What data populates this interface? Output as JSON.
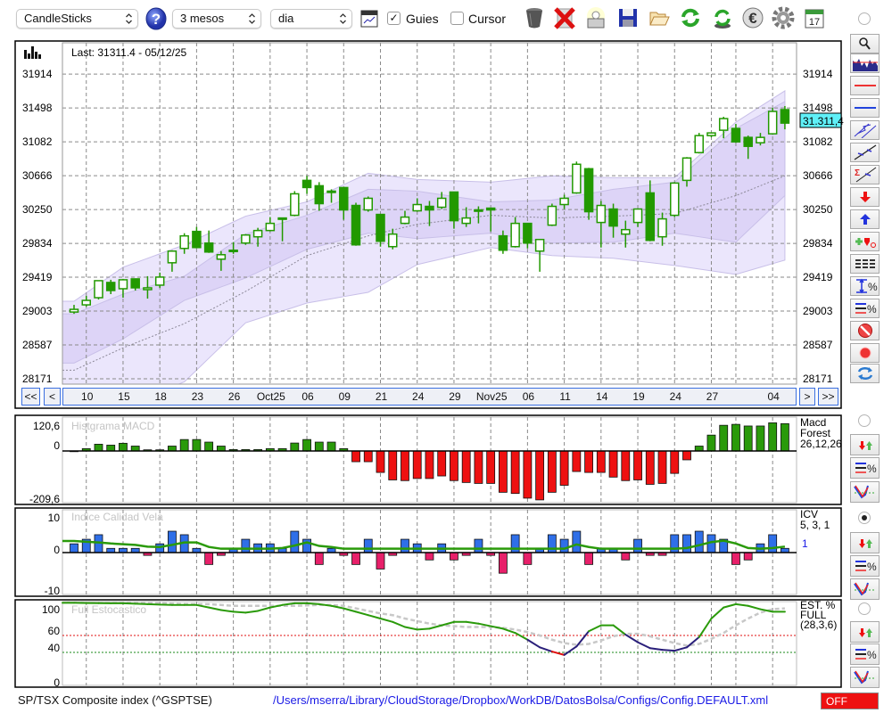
{
  "toolbar": {
    "chart_type": "CandleSticks",
    "period": "3 mesos",
    "interval": "dia",
    "guides_label": "Guies",
    "guides_checked": true,
    "guides_mark": "✓",
    "cursor_label": "Cursor",
    "cursor_checked": false,
    "help_glyph": "?",
    "calendar_day": "17",
    "icons": [
      "help-icon",
      "chart-settings-icon",
      "trash-icon",
      "delete-icon",
      "lamp-icon",
      "save-icon",
      "folder-open-icon",
      "refresh-icon",
      "sync-icon",
      "euro-icon",
      "gear-icon",
      "calendar-icon"
    ]
  },
  "main_chart": {
    "last_label": "Last: 31311.4 - 05/12/25",
    "price_tag": "31.311,4",
    "nav": {
      "first": "<<",
      "prev": "<",
      "next": ">",
      "last": ">>"
    }
  },
  "side_panel": {
    "tools": [
      "zoom-icon",
      "overview-icon",
      "red-line-icon",
      "blue-line-icon",
      "channel-icon",
      "trendline-icon",
      "sum-trendline-icon",
      "sell-arrow-icon",
      "buy-arrow-icon",
      "add-signal-icon",
      "dashed-lines-icon",
      "percent-range-icon",
      "percent-lines-icon",
      "no-entry-icon",
      "record-icon",
      "swap-icon"
    ]
  },
  "status": {
    "instrument": "SP/TSX Composite index (^GSPTSE)",
    "config_path": "/Users/mserra/Library/CloudStorage/Dropbox/WorkDB/DatosBolsa/Configs/Config.DEFAULT.xml",
    "off_label": "OFF"
  },
  "colors": {
    "candle": "#229900",
    "macd_pos": "#2a9a0a",
    "macd_neg": "#ee1111",
    "icv_pos": "#2f6fe8",
    "icv_neg": "#e8206a",
    "band_outer": "#ebe6fc",
    "band_inner": "#ddd4f7",
    "off": "#ee1111",
    "price_tag": "#5ff0f8"
  },
  "chart_data": [
    {
      "type": "candlestick",
      "title": "SP/TSX Composite index (^GSPTSE)",
      "ylim": [
        28171,
        32000
      ],
      "y_ticks": [
        "28171",
        "28587",
        "29003",
        "29419",
        "29834",
        "30250",
        "30666",
        "31082",
        "31498",
        "31914"
      ],
      "y_tick_values": [
        28171,
        28587,
        29003,
        29419,
        29834,
        30250,
        30666,
        31082,
        31498,
        31914
      ],
      "x_labels": [
        {
          "index": 1,
          "label": "10"
        },
        {
          "index": 4,
          "label": "15"
        },
        {
          "index": 7,
          "label": "18"
        },
        {
          "index": 10,
          "label": "23"
        },
        {
          "index": 13,
          "label": "26"
        },
        {
          "index": 16,
          "label": "Oct25"
        },
        {
          "index": 19,
          "label": "06"
        },
        {
          "index": 22,
          "label": "09"
        },
        {
          "index": 25,
          "label": "21"
        },
        {
          "index": 28,
          "label": "24"
        },
        {
          "index": 31,
          "label": "29"
        },
        {
          "index": 34,
          "label": "Nov25"
        },
        {
          "index": 37,
          "label": "06"
        },
        {
          "index": 40,
          "label": "11"
        },
        {
          "index": 43,
          "label": "14"
        },
        {
          "index": 46,
          "label": "19"
        },
        {
          "index": 49,
          "label": "24"
        },
        {
          "index": 52,
          "label": "27"
        },
        {
          "index": 57,
          "label": "04"
        }
      ],
      "ohlc": [
        [
          28991,
          29079,
          28969,
          29024
        ],
        [
          29079,
          29189,
          29057,
          29134
        ],
        [
          29167,
          29376,
          29145,
          29376
        ],
        [
          29354,
          29387,
          29211,
          29255
        ],
        [
          29277,
          29398,
          29167,
          29387
        ],
        [
          29398,
          29398,
          29255,
          29288
        ],
        [
          29266,
          29431,
          29156,
          29288
        ],
        [
          29321,
          29475,
          29288,
          29420
        ],
        [
          29596,
          29750,
          29486,
          29739
        ],
        [
          29772,
          29959,
          29706,
          29926
        ],
        [
          29981,
          30036,
          29772,
          29783
        ],
        [
          29838,
          29992,
          29717,
          29728
        ],
        [
          29640,
          29739,
          29497,
          29695
        ],
        [
          29750,
          29849,
          29706,
          29739
        ],
        [
          29838,
          29948,
          29816,
          29937
        ],
        [
          29915,
          30025,
          29794,
          29992
        ],
        [
          29992,
          30157,
          29981,
          30080
        ],
        [
          30135,
          30146,
          29860,
          30146
        ],
        [
          30179,
          30476,
          30168,
          30443
        ],
        [
          30608,
          30663,
          30443,
          30520
        ],
        [
          30542,
          30586,
          30234,
          30322
        ],
        [
          30465,
          30498,
          30333,
          30476
        ],
        [
          30520,
          30520,
          30124,
          30245
        ],
        [
          30300,
          30333,
          29805,
          29816
        ],
        [
          30245,
          30410,
          30223,
          30388
        ],
        [
          30190,
          30190,
          29794,
          29860
        ],
        [
          29794,
          30014,
          29761,
          29948
        ],
        [
          30080,
          30234,
          30069,
          30157
        ],
        [
          30234,
          30388,
          30223,
          30311
        ],
        [
          30289,
          30355,
          30047,
          30245
        ],
        [
          30278,
          30465,
          30256,
          30388
        ],
        [
          30465,
          30465,
          30014,
          30113
        ],
        [
          30080,
          30278,
          30036,
          30146
        ],
        [
          30234,
          30289,
          30080,
          30245
        ],
        [
          30267,
          30267,
          29981,
          30245
        ],
        [
          29926,
          29992,
          29706,
          29750
        ],
        [
          29794,
          30157,
          29783,
          30080
        ],
        [
          30080,
          30080,
          29772,
          29838
        ],
        [
          29739,
          29882,
          29486,
          29882
        ],
        [
          30058,
          30322,
          30047,
          30289
        ],
        [
          30311,
          30432,
          30256,
          30388
        ],
        [
          30454,
          30839,
          30443,
          30806
        ],
        [
          30751,
          30762,
          30124,
          30223
        ],
        [
          30091,
          30355,
          29783,
          30300
        ],
        [
          30256,
          30322,
          29904,
          30047
        ],
        [
          29948,
          30113,
          29783,
          30003
        ],
        [
          30091,
          30256,
          30036,
          30256
        ],
        [
          30454,
          30608,
          29860,
          29871
        ],
        [
          29915,
          30212,
          29805,
          30135
        ],
        [
          30179,
          30586,
          30157,
          30575
        ],
        [
          30608,
          30894,
          30531,
          30883
        ],
        [
          30949,
          31191,
          30938,
          31158
        ],
        [
          31158,
          31191,
          31136,
          31191
        ],
        [
          31224,
          31389,
          31125,
          31367
        ],
        [
          31246,
          31301,
          31070,
          31081
        ],
        [
          31136,
          31158,
          30872,
          31026
        ],
        [
          31070,
          31191,
          31037,
          31136
        ],
        [
          31180,
          31499,
          31169,
          31455
        ],
        [
          31477,
          31521,
          31235,
          31311.4
        ]
      ],
      "last_close": 31311.4,
      "bands": {
        "anchor_index": [
          0,
          4,
          9,
          14,
          19,
          24,
          28,
          34,
          39,
          44,
          49,
          54,
          58
        ],
        "upper_outer": [
          29123,
          29541,
          29816,
          30168,
          30344,
          30696,
          30619,
          30586,
          30663,
          30641,
          30641,
          31323,
          31708
        ],
        "upper_inner": [
          28969,
          29211,
          29431,
          29948,
          30179,
          30498,
          30476,
          30344,
          30366,
          30498,
          30586,
          31246,
          31576
        ],
        "middle": [
          28276,
          28551,
          28848,
          29244,
          29684,
          29926,
          30069,
          30179,
          30146,
          30168,
          30201,
          30421,
          30663
        ],
        "lower_inner": [
          28364,
          28661,
          29134,
          29409,
          29761,
          29959,
          29893,
          29959,
          29838,
          29849,
          29959,
          29849,
          30421
        ],
        "lower_outer": [
          27671,
          27836,
          28133,
          28859,
          29101,
          29233,
          29574,
          29783,
          29684,
          29651,
          29563,
          29453,
          29629
        ]
      }
    },
    {
      "type": "bar",
      "title": "Histgrama MACD",
      "legend": [
        "Macd",
        "Forest",
        "26,12,26"
      ],
      "y_ticks": [
        "120,6",
        "0",
        "-209,6"
      ],
      "ylim": [
        -209.6,
        120.6
      ],
      "values": [
        0,
        10,
        29,
        25,
        33,
        21,
        5,
        5,
        21,
        49,
        49,
        38,
        21,
        6,
        6,
        6,
        10,
        10,
        34,
        49,
        38,
        38,
        10,
        -46,
        -46,
        -92,
        -124,
        -127,
        -118,
        -118,
        -107,
        -127,
        -135,
        -139,
        -139,
        -177,
        -182,
        -202,
        -209.6,
        -177,
        -147,
        -88,
        -92,
        -92,
        -112,
        -127,
        -124,
        -143,
        -139,
        -96,
        -38,
        21,
        68,
        110,
        114,
        107,
        107,
        120.6,
        117
      ]
    },
    {
      "type": "bar",
      "title": "Indice Calidad Vela",
      "legend": [
        "ICV",
        "5, 3, 1",
        "1"
      ],
      "y_ticks": [
        "10",
        "0",
        "-10"
      ],
      "ylim": [
        -10,
        10
      ],
      "values": [
        2.5,
        3.8,
        5.1,
        1.2,
        1.2,
        1.2,
        -0.8,
        2.5,
        6.1,
        5.1,
        1.2,
        -3.4,
        -0.8,
        1.2,
        3.8,
        2.5,
        2.5,
        1.2,
        6.1,
        3.8,
        -3.4,
        1.2,
        -0.8,
        -3.4,
        3.8,
        -4.7,
        -0.8,
        3.8,
        2.5,
        -2.1,
        2.5,
        -2.1,
        -0.8,
        3.8,
        -0.8,
        -5.9,
        5.1,
        -3.4,
        1.2,
        5.1,
        3.8,
        6.1,
        -3.4,
        1.2,
        1.2,
        -2.1,
        3.8,
        -0.8,
        -0.8,
        5.1,
        5.1,
        6.1,
        5.1,
        3.8,
        -3.4,
        -2.1,
        2.5,
        5.1,
        1.2
      ],
      "signal": [
        3.3,
        3.1,
        2.9,
        2.6,
        2.4,
        2.2,
        1.7,
        1.6,
        2.2,
        2.9,
        2.9,
        1.6,
        1.1,
        1.1,
        1.1,
        1.1,
        1.1,
        1.3,
        2.0,
        2.9,
        1.9,
        1.6,
        1.1,
        1.1,
        1.1,
        1.1,
        1.1,
        1.1,
        1.1,
        1.1,
        1.1,
        1.1,
        1.1,
        1.1,
        1.1,
        1.1,
        1.1,
        1.1,
        1.1,
        1.1,
        1.1,
        2.3,
        1.6,
        1.1,
        1.1,
        1.1,
        1.1,
        1.1,
        1.1,
        1.1,
        1.3,
        2.1,
        3.0,
        3.4,
        2.6,
        1.3,
        1.1,
        1.3,
        1.7
      ]
    },
    {
      "type": "line",
      "title": "Full Estocastico",
      "legend": [
        "EST. %",
        "FULL",
        "(28,3,6)"
      ],
      "y_ticks": [
        "100",
        "60",
        "40",
        "0"
      ],
      "y_tick_values": [
        100,
        60,
        40,
        0
      ],
      "ylim": [
        0,
        100
      ],
      "levels": {
        "upper": 60,
        "lower": 40
      },
      "series": [
        {
          "name": "%K",
          "values": [
            98.5,
            98.3,
            98.2,
            98,
            98,
            97.5,
            97,
            96.5,
            96,
            96,
            96,
            93,
            90,
            88,
            87,
            89,
            93,
            96,
            98,
            98,
            97,
            95,
            92,
            88,
            84,
            80,
            76,
            70,
            67,
            68,
            72,
            76,
            76,
            74,
            71,
            68,
            63,
            55,
            46,
            41,
            37,
            47,
            65,
            72,
            72,
            61,
            52,
            45,
            43,
            42,
            46,
            58,
            80,
            93,
            97,
            95,
            91,
            88,
            88
          ]
        },
        {
          "name": "%D",
          "values": [
            99,
            99,
            99,
            98.5,
            98.5,
            98,
            98,
            98,
            97.5,
            97,
            97,
            97,
            96,
            95,
            95,
            95,
            95,
            95,
            95,
            95.5,
            96,
            96,
            95,
            92,
            89,
            86,
            84,
            80,
            77,
            74,
            72,
            71,
            70,
            70,
            70,
            69,
            67,
            64,
            60,
            55,
            51,
            49,
            50,
            54,
            59,
            62,
            62,
            59,
            55,
            51,
            48,
            50,
            56,
            63,
            72,
            80,
            87,
            91,
            92
          ]
        }
      ]
    }
  ]
}
